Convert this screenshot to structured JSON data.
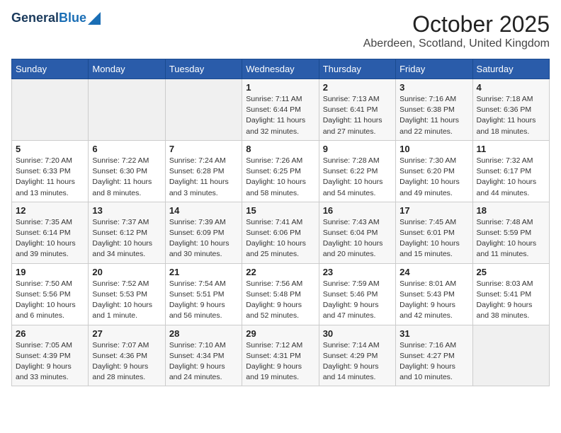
{
  "logo": {
    "line1": "General",
    "line2": "Blue"
  },
  "title": "October 2025",
  "subtitle": "Aberdeen, Scotland, United Kingdom",
  "weekdays": [
    "Sunday",
    "Monday",
    "Tuesday",
    "Wednesday",
    "Thursday",
    "Friday",
    "Saturday"
  ],
  "weeks": [
    [
      {
        "day": "",
        "info": ""
      },
      {
        "day": "",
        "info": ""
      },
      {
        "day": "",
        "info": ""
      },
      {
        "day": "1",
        "info": "Sunrise: 7:11 AM\nSunset: 6:44 PM\nDaylight: 11 hours\nand 32 minutes."
      },
      {
        "day": "2",
        "info": "Sunrise: 7:13 AM\nSunset: 6:41 PM\nDaylight: 11 hours\nand 27 minutes."
      },
      {
        "day": "3",
        "info": "Sunrise: 7:16 AM\nSunset: 6:38 PM\nDaylight: 11 hours\nand 22 minutes."
      },
      {
        "day": "4",
        "info": "Sunrise: 7:18 AM\nSunset: 6:36 PM\nDaylight: 11 hours\nand 18 minutes."
      }
    ],
    [
      {
        "day": "5",
        "info": "Sunrise: 7:20 AM\nSunset: 6:33 PM\nDaylight: 11 hours\nand 13 minutes."
      },
      {
        "day": "6",
        "info": "Sunrise: 7:22 AM\nSunset: 6:30 PM\nDaylight: 11 hours\nand 8 minutes."
      },
      {
        "day": "7",
        "info": "Sunrise: 7:24 AM\nSunset: 6:28 PM\nDaylight: 11 hours\nand 3 minutes."
      },
      {
        "day": "8",
        "info": "Sunrise: 7:26 AM\nSunset: 6:25 PM\nDaylight: 10 hours\nand 58 minutes."
      },
      {
        "day": "9",
        "info": "Sunrise: 7:28 AM\nSunset: 6:22 PM\nDaylight: 10 hours\nand 54 minutes."
      },
      {
        "day": "10",
        "info": "Sunrise: 7:30 AM\nSunset: 6:20 PM\nDaylight: 10 hours\nand 49 minutes."
      },
      {
        "day": "11",
        "info": "Sunrise: 7:32 AM\nSunset: 6:17 PM\nDaylight: 10 hours\nand 44 minutes."
      }
    ],
    [
      {
        "day": "12",
        "info": "Sunrise: 7:35 AM\nSunset: 6:14 PM\nDaylight: 10 hours\nand 39 minutes."
      },
      {
        "day": "13",
        "info": "Sunrise: 7:37 AM\nSunset: 6:12 PM\nDaylight: 10 hours\nand 34 minutes."
      },
      {
        "day": "14",
        "info": "Sunrise: 7:39 AM\nSunset: 6:09 PM\nDaylight: 10 hours\nand 30 minutes."
      },
      {
        "day": "15",
        "info": "Sunrise: 7:41 AM\nSunset: 6:06 PM\nDaylight: 10 hours\nand 25 minutes."
      },
      {
        "day": "16",
        "info": "Sunrise: 7:43 AM\nSunset: 6:04 PM\nDaylight: 10 hours\nand 20 minutes."
      },
      {
        "day": "17",
        "info": "Sunrise: 7:45 AM\nSunset: 6:01 PM\nDaylight: 10 hours\nand 15 minutes."
      },
      {
        "day": "18",
        "info": "Sunrise: 7:48 AM\nSunset: 5:59 PM\nDaylight: 10 hours\nand 11 minutes."
      }
    ],
    [
      {
        "day": "19",
        "info": "Sunrise: 7:50 AM\nSunset: 5:56 PM\nDaylight: 10 hours\nand 6 minutes."
      },
      {
        "day": "20",
        "info": "Sunrise: 7:52 AM\nSunset: 5:53 PM\nDaylight: 10 hours\nand 1 minute."
      },
      {
        "day": "21",
        "info": "Sunrise: 7:54 AM\nSunset: 5:51 PM\nDaylight: 9 hours\nand 56 minutes."
      },
      {
        "day": "22",
        "info": "Sunrise: 7:56 AM\nSunset: 5:48 PM\nDaylight: 9 hours\nand 52 minutes."
      },
      {
        "day": "23",
        "info": "Sunrise: 7:59 AM\nSunset: 5:46 PM\nDaylight: 9 hours\nand 47 minutes."
      },
      {
        "day": "24",
        "info": "Sunrise: 8:01 AM\nSunset: 5:43 PM\nDaylight: 9 hours\nand 42 minutes."
      },
      {
        "day": "25",
        "info": "Sunrise: 8:03 AM\nSunset: 5:41 PM\nDaylight: 9 hours\nand 38 minutes."
      }
    ],
    [
      {
        "day": "26",
        "info": "Sunrise: 7:05 AM\nSunset: 4:39 PM\nDaylight: 9 hours\nand 33 minutes."
      },
      {
        "day": "27",
        "info": "Sunrise: 7:07 AM\nSunset: 4:36 PM\nDaylight: 9 hours\nand 28 minutes."
      },
      {
        "day": "28",
        "info": "Sunrise: 7:10 AM\nSunset: 4:34 PM\nDaylight: 9 hours\nand 24 minutes."
      },
      {
        "day": "29",
        "info": "Sunrise: 7:12 AM\nSunset: 4:31 PM\nDaylight: 9 hours\nand 19 minutes."
      },
      {
        "day": "30",
        "info": "Sunrise: 7:14 AM\nSunset: 4:29 PM\nDaylight: 9 hours\nand 14 minutes."
      },
      {
        "day": "31",
        "info": "Sunrise: 7:16 AM\nSunset: 4:27 PM\nDaylight: 9 hours\nand 10 minutes."
      },
      {
        "day": "",
        "info": ""
      }
    ]
  ]
}
